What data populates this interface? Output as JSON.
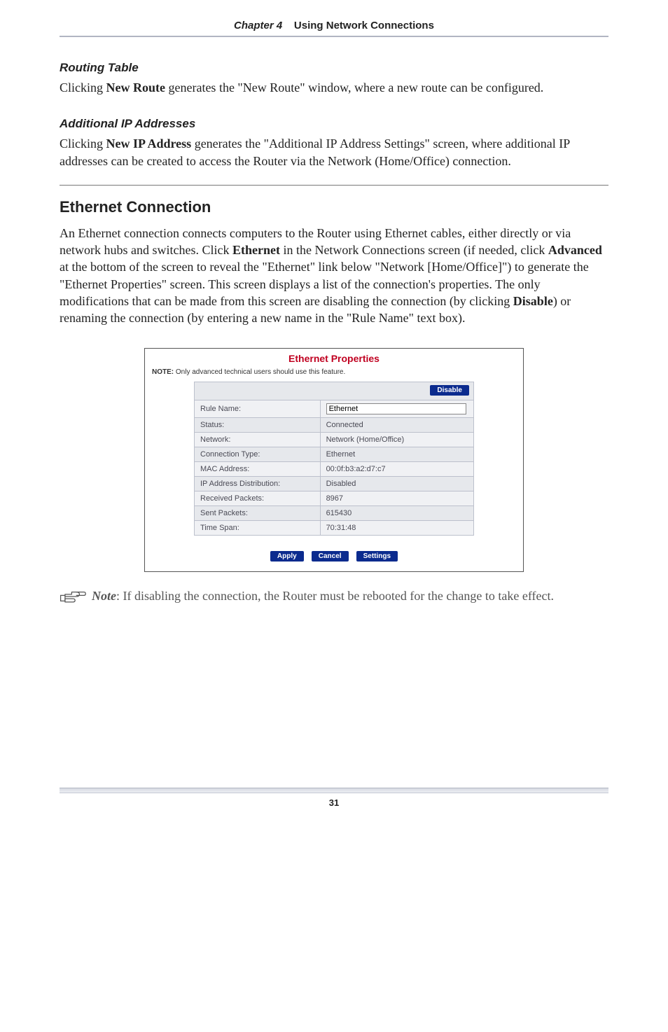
{
  "header": {
    "chapter": "Chapter 4",
    "title": "Using Network Connections"
  },
  "routingTable": {
    "heading": "Routing Table",
    "para_pre": "Clicking ",
    "para_bold": "New Route",
    "para_post": " generates the \"New Route\" window, where a new route can be configured."
  },
  "additionalIP": {
    "heading": "Additional IP Addresses",
    "para_pre": "Clicking ",
    "para_bold": "New IP Address",
    "para_post_1": " generates the \"Additional ",
    "para_small": "IP",
    "para_post_2": " Address Settings\" screen, where additional IP addresses can be created to access the Router via the Network (Home/Office) connection."
  },
  "ethernet": {
    "heading": "Ethernet Connection",
    "p1": "An Ethernet connection connects computers to the Router using Ethernet cables, either directly or via network hubs and switches. Click ",
    "b1": "Ethernet",
    "p2": " in the Network Connections screen (if needed, click ",
    "b2": "Advanced",
    "p3": " at the bottom of the screen to reveal the \"Ethernet\" link below \"Network [Home/Office]\") to generate the \"Ethernet Properties\" screen. This screen displays a list of the connection's properties. The only modifications that can be made from this screen are disabling the connection (by clicking ",
    "b3": "Disable",
    "p4": ") or renaming the connection (by entering a new name in the \"Rule Name\" text box)."
  },
  "screenshot": {
    "title": "Ethernet Properties",
    "note_label": "NOTE:",
    "note_text": " Only advanced technical users should use this feature.",
    "disable_btn": "Disable",
    "rows": [
      {
        "label": "Rule Name:",
        "value": "Ethernet",
        "input": true
      },
      {
        "label": "Status:",
        "value": "Connected",
        "connected": true
      },
      {
        "label": "Network:",
        "value": "Network (Home/Office)"
      },
      {
        "label": "Connection Type:",
        "value": "Ethernet"
      },
      {
        "label": "MAC Address:",
        "value": "00:0f:b3:a2:d7:c7"
      },
      {
        "label": "IP Address Distribution:",
        "value": "Disabled"
      },
      {
        "label": "Received Packets:",
        "value": "8967"
      },
      {
        "label": "Sent Packets:",
        "value": "615430"
      },
      {
        "label": "Time Span:",
        "value": "70:31:48"
      }
    ],
    "apply": "Apply",
    "cancel": "Cancel",
    "settings": "Settings"
  },
  "note": {
    "label": "Note",
    "text": ": If disabling the connection, the Router must be rebooted for the change to take effect."
  },
  "footer": {
    "page": "31"
  }
}
